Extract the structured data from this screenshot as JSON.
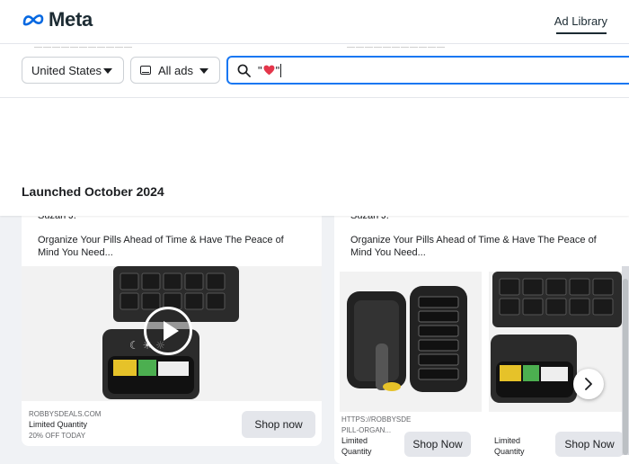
{
  "header": {
    "brand": "Meta",
    "nav_link": "Ad Library"
  },
  "filters": {
    "country": "United States",
    "ad_type": "All ads",
    "search_value_prefix": "\"",
    "search_value_suffix": "\""
  },
  "section": {
    "title": "Launched October 2024"
  },
  "cards": [
    {
      "advertiser": "Suzan J.",
      "body": "Organize Your Pills Ahead of Time & Have The Peace of Mind You Need...",
      "domain": "ROBBYSDEALS.COM",
      "headline": "Limited Quantity",
      "description": "20% OFF TODAY",
      "cta": "Shop now"
    },
    {
      "advertiser": "Suzan J.",
      "body": "Organize Your Pills Ahead of Time & Have The Peace of Mind You Need...",
      "domain_line1": "HTTPS://ROBBYSDE",
      "domain_line2": "PILL-ORGAN...",
      "headline_line1": "Limited",
      "headline_line2": "Quantity",
      "cta": "Shop Now",
      "headline2_line1": "Limited",
      "headline2_line2": "Quantity",
      "cta2": "Shop Now"
    }
  ],
  "colors": {
    "accent": "#1877f2",
    "heart": "#e4364b",
    "meta_blue": "#0668e1"
  }
}
